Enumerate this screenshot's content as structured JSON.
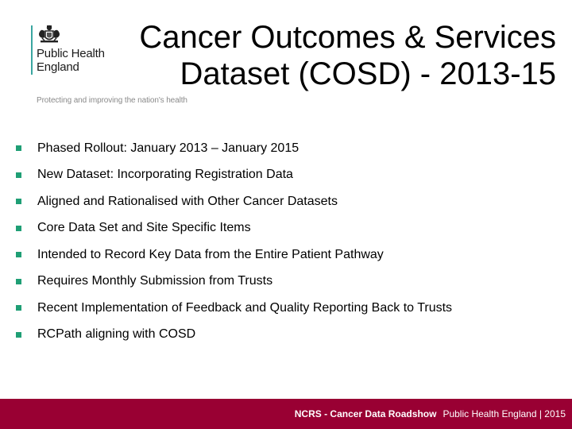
{
  "logo": {
    "organisation_line1": "Public Health",
    "organisation_line2": "England",
    "icon": "royal-crest-icon",
    "tagline": "Protecting and improving the nation's health"
  },
  "title": {
    "line1": "Cancer Outcomes & Services",
    "line2": "Dataset (COSD) -  2013-15"
  },
  "bullets": {
    "marker_color": "#1f9f75",
    "items": [
      "Phased Rollout: January 2013 – January 2015",
      "New Dataset: Incorporating Registration Data",
      "Aligned and Rationalised with Other Cancer Datasets",
      "Core Data Set and Site Specific Items",
      "Intended to Record Key Data from the Entire Patient Pathway",
      "Requires Monthly Submission from Trusts",
      "Recent Implementation of Feedback and Quality Reporting Back to Trusts",
      "RCPath aligning with COSD"
    ]
  },
  "footer": {
    "background_color": "#990033",
    "event": "NCRS -  Cancer Data Roadshow",
    "organisation_year": "Public Health England | 2015"
  }
}
